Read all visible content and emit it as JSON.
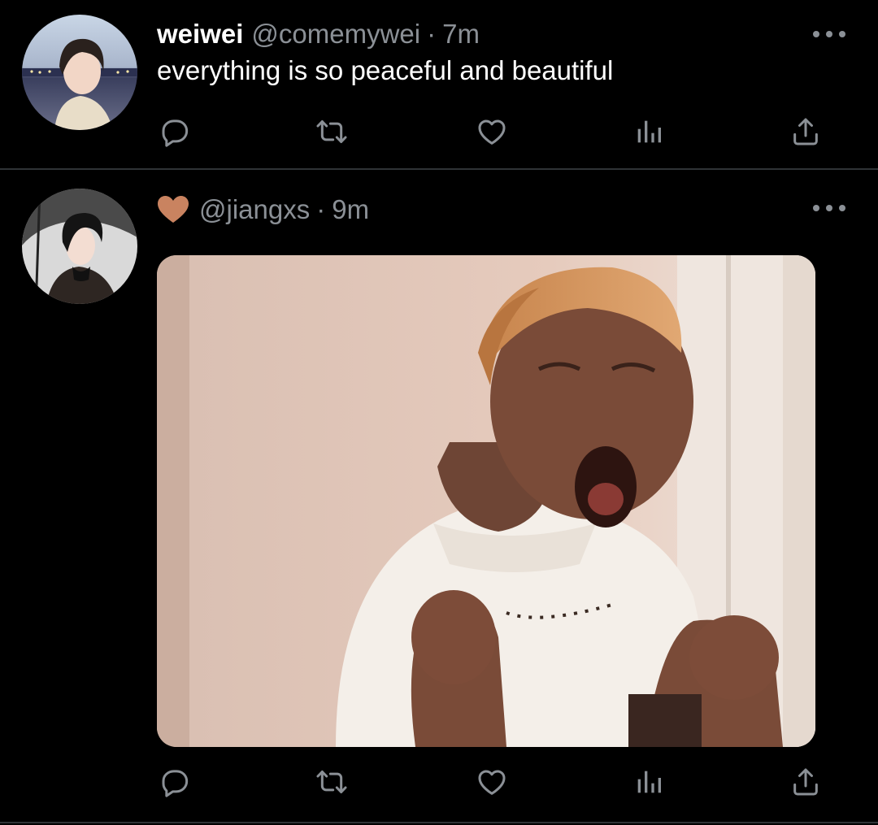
{
  "tweets": [
    {
      "display_name": "weiwei",
      "handle": "@comemywei",
      "separator": "·",
      "time": "7m",
      "text": "everything is so peaceful and beautiful",
      "avatar_icon": "user-avatar"
    },
    {
      "display_name": "",
      "name_emoji": "brown-heart-emoji",
      "handle": "@jiangxs",
      "separator": "·",
      "time": "9m",
      "text": "",
      "avatar_icon": "user-avatar",
      "media": "photo"
    }
  ],
  "actions": {
    "icons": [
      "reply-icon",
      "retweet-icon",
      "like-icon",
      "views-icon",
      "share-icon"
    ]
  },
  "colors": {
    "background": "#000000",
    "primary_text": "#ffffff",
    "secondary_text": "#8b9096",
    "divider": "#2f3336",
    "heart_emoji": "#c98360"
  }
}
